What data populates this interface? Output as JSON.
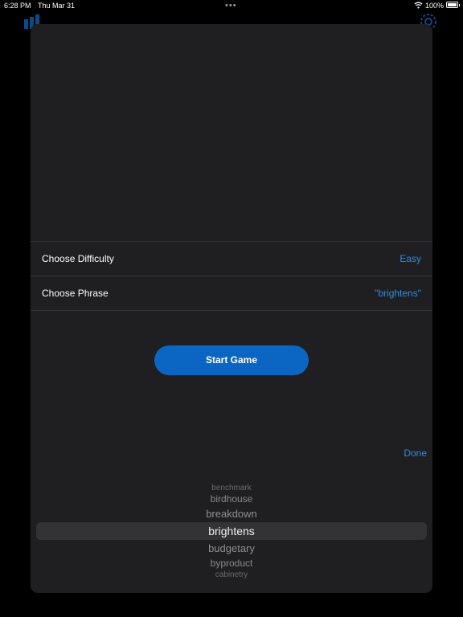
{
  "status_bar": {
    "time": "6:28 PM",
    "date": "Thu Mar 31",
    "battery_percent": "100%"
  },
  "settings": {
    "difficulty_label": "Choose Difficulty",
    "difficulty_value": "Easy",
    "phrase_label": "Choose Phrase",
    "phrase_value": "\"brightens\""
  },
  "start_button_label": "Start Game",
  "picker": {
    "done_label": "Done",
    "items": [
      "",
      "benchmark",
      "birdhouse",
      "breakdown",
      "brightens",
      "budgetary",
      "byproduct",
      "cabinetry",
      ""
    ],
    "selected_index": 4
  },
  "colors": {
    "accent": "#2e8be6",
    "button": "#0a66c2",
    "sheet_bg": "#1f1f21"
  },
  "icons": [
    "chart-icon",
    "gear-icon",
    "wifi-icon",
    "battery-icon"
  ]
}
